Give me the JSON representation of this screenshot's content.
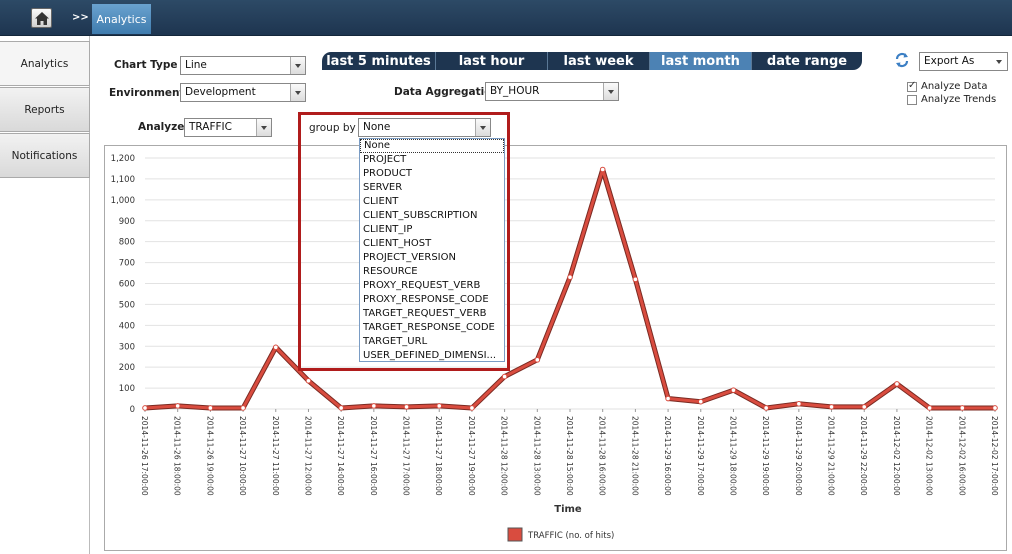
{
  "topbar": {
    "crumb_separator": ">>",
    "active_crumb": "Analytics"
  },
  "leftnav": {
    "items": [
      "Analytics",
      "Reports",
      "Notifications"
    ]
  },
  "filters": {
    "chart_type_label": "Chart Type :",
    "chart_type_value": "Line",
    "environment_label": "Environment :",
    "environment_value": "Development",
    "analyze_label": "Analyze :",
    "analyze_value": "TRAFFIC",
    "group_by_label": "group by :",
    "group_by_value": "None",
    "aggregation_label": "Data Aggregation :",
    "aggregation_value": "BY_HOUR"
  },
  "time_tabs": [
    "last 5 minutes",
    "last hour",
    "last week",
    "last month",
    "date range"
  ],
  "active_time_tab": "last month",
  "export": {
    "value": "Export As"
  },
  "options": {
    "analyze_data": "Analyze Data",
    "analyze_trends": "Analyze Trends"
  },
  "group_by_options": [
    "None",
    "PROJECT",
    "PRODUCT",
    "SERVER",
    "CLIENT",
    "CLIENT_SUBSCRIPTION",
    "CLIENT_IP",
    "CLIENT_HOST",
    "PROJECT_VERSION",
    "RESOURCE",
    "PROXY_REQUEST_VERB",
    "PROXY_RESPONSE_CODE",
    "TARGET_REQUEST_VERB",
    "TARGET_RESPONSE_CODE",
    "TARGET_URL",
    "USER_DEFINED_DIMENSI..."
  ],
  "colors": {
    "series": "#d94c3f",
    "series_dark": "#7a2a22",
    "topbar": "#1e3550",
    "tab_active": "#4c82b4"
  },
  "chart_data": {
    "type": "line",
    "x": [
      "2014-11-26 17:00:00",
      "2014-11-26 18:00:00",
      "2014-11-26 19:00:00",
      "2014-11-27 10:00:00",
      "2014-11-27 11:00:00",
      "2014-11-27 12:00:00",
      "2014-11-27 14:00:00",
      "2014-11-27 16:00:00",
      "2014-11-27 17:00:00",
      "2014-11-27 18:00:00",
      "2014-11-27 19:00:00",
      "2014-11-28 12:00:00",
      "2014-11-28 13:00:00",
      "2014-11-28 15:00:00",
      "2014-11-28 16:00:00",
      "2014-11-28 21:00:00",
      "2014-11-29 16:00:00",
      "2014-11-29 17:00:00",
      "2014-11-29 18:00:00",
      "2014-11-29 19:00:00",
      "2014-11-29 20:00:00",
      "2014-11-29 21:00:00",
      "2014-11-29 22:00:00",
      "2014-12-02 12:00:00",
      "2014-12-02 13:00:00",
      "2014-12-02 16:00:00",
      "2014-12-02 17:00:00"
    ],
    "series": [
      {
        "name": "TRAFFIC (no. of hits)",
        "values": [
          5,
          15,
          5,
          5,
          295,
          135,
          5,
          15,
          10,
          15,
          5,
          155,
          235,
          630,
          1145,
          620,
          50,
          35,
          90,
          5,
          25,
          10,
          10,
          120,
          5,
          5,
          5
        ]
      }
    ],
    "xlabel": "Time",
    "ylabel": "",
    "ylim": [
      0,
      1200
    ],
    "yticks": [
      0,
      100,
      200,
      300,
      400,
      500,
      600,
      700,
      800,
      900,
      1000,
      1100,
      1200
    ],
    "ytick_labels": [
      "0",
      "100",
      "200",
      "300",
      "400",
      "500",
      "600",
      "700",
      "800",
      "900",
      "1,000",
      "1,100",
      "1,200"
    ],
    "grid": true,
    "legend": "bottom-center"
  }
}
